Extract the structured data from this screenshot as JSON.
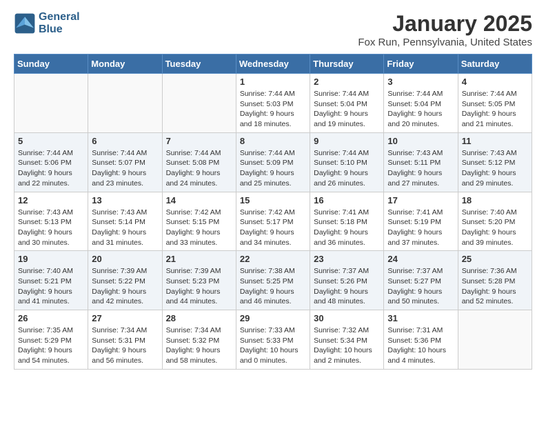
{
  "logo": {
    "line1": "General",
    "line2": "Blue"
  },
  "title": "January 2025",
  "location": "Fox Run, Pennsylvania, United States",
  "days_header": [
    "Sunday",
    "Monday",
    "Tuesday",
    "Wednesday",
    "Thursday",
    "Friday",
    "Saturday"
  ],
  "weeks": [
    [
      {
        "day": "",
        "content": ""
      },
      {
        "day": "",
        "content": ""
      },
      {
        "day": "",
        "content": ""
      },
      {
        "day": "1",
        "content": "Sunrise: 7:44 AM\nSunset: 5:03 PM\nDaylight: 9 hours\nand 18 minutes."
      },
      {
        "day": "2",
        "content": "Sunrise: 7:44 AM\nSunset: 5:04 PM\nDaylight: 9 hours\nand 19 minutes."
      },
      {
        "day": "3",
        "content": "Sunrise: 7:44 AM\nSunset: 5:04 PM\nDaylight: 9 hours\nand 20 minutes."
      },
      {
        "day": "4",
        "content": "Sunrise: 7:44 AM\nSunset: 5:05 PM\nDaylight: 9 hours\nand 21 minutes."
      }
    ],
    [
      {
        "day": "5",
        "content": "Sunrise: 7:44 AM\nSunset: 5:06 PM\nDaylight: 9 hours\nand 22 minutes."
      },
      {
        "day": "6",
        "content": "Sunrise: 7:44 AM\nSunset: 5:07 PM\nDaylight: 9 hours\nand 23 minutes."
      },
      {
        "day": "7",
        "content": "Sunrise: 7:44 AM\nSunset: 5:08 PM\nDaylight: 9 hours\nand 24 minutes."
      },
      {
        "day": "8",
        "content": "Sunrise: 7:44 AM\nSunset: 5:09 PM\nDaylight: 9 hours\nand 25 minutes."
      },
      {
        "day": "9",
        "content": "Sunrise: 7:44 AM\nSunset: 5:10 PM\nDaylight: 9 hours\nand 26 minutes."
      },
      {
        "day": "10",
        "content": "Sunrise: 7:43 AM\nSunset: 5:11 PM\nDaylight: 9 hours\nand 27 minutes."
      },
      {
        "day": "11",
        "content": "Sunrise: 7:43 AM\nSunset: 5:12 PM\nDaylight: 9 hours\nand 29 minutes."
      }
    ],
    [
      {
        "day": "12",
        "content": "Sunrise: 7:43 AM\nSunset: 5:13 PM\nDaylight: 9 hours\nand 30 minutes."
      },
      {
        "day": "13",
        "content": "Sunrise: 7:43 AM\nSunset: 5:14 PM\nDaylight: 9 hours\nand 31 minutes."
      },
      {
        "day": "14",
        "content": "Sunrise: 7:42 AM\nSunset: 5:15 PM\nDaylight: 9 hours\nand 33 minutes."
      },
      {
        "day": "15",
        "content": "Sunrise: 7:42 AM\nSunset: 5:17 PM\nDaylight: 9 hours\nand 34 minutes."
      },
      {
        "day": "16",
        "content": "Sunrise: 7:41 AM\nSunset: 5:18 PM\nDaylight: 9 hours\nand 36 minutes."
      },
      {
        "day": "17",
        "content": "Sunrise: 7:41 AM\nSunset: 5:19 PM\nDaylight: 9 hours\nand 37 minutes."
      },
      {
        "day": "18",
        "content": "Sunrise: 7:40 AM\nSunset: 5:20 PM\nDaylight: 9 hours\nand 39 minutes."
      }
    ],
    [
      {
        "day": "19",
        "content": "Sunrise: 7:40 AM\nSunset: 5:21 PM\nDaylight: 9 hours\nand 41 minutes."
      },
      {
        "day": "20",
        "content": "Sunrise: 7:39 AM\nSunset: 5:22 PM\nDaylight: 9 hours\nand 42 minutes."
      },
      {
        "day": "21",
        "content": "Sunrise: 7:39 AM\nSunset: 5:23 PM\nDaylight: 9 hours\nand 44 minutes."
      },
      {
        "day": "22",
        "content": "Sunrise: 7:38 AM\nSunset: 5:25 PM\nDaylight: 9 hours\nand 46 minutes."
      },
      {
        "day": "23",
        "content": "Sunrise: 7:37 AM\nSunset: 5:26 PM\nDaylight: 9 hours\nand 48 minutes."
      },
      {
        "day": "24",
        "content": "Sunrise: 7:37 AM\nSunset: 5:27 PM\nDaylight: 9 hours\nand 50 minutes."
      },
      {
        "day": "25",
        "content": "Sunrise: 7:36 AM\nSunset: 5:28 PM\nDaylight: 9 hours\nand 52 minutes."
      }
    ],
    [
      {
        "day": "26",
        "content": "Sunrise: 7:35 AM\nSunset: 5:29 PM\nDaylight: 9 hours\nand 54 minutes."
      },
      {
        "day": "27",
        "content": "Sunrise: 7:34 AM\nSunset: 5:31 PM\nDaylight: 9 hours\nand 56 minutes."
      },
      {
        "day": "28",
        "content": "Sunrise: 7:34 AM\nSunset: 5:32 PM\nDaylight: 9 hours\nand 58 minutes."
      },
      {
        "day": "29",
        "content": "Sunrise: 7:33 AM\nSunset: 5:33 PM\nDaylight: 10 hours\nand 0 minutes."
      },
      {
        "day": "30",
        "content": "Sunrise: 7:32 AM\nSunset: 5:34 PM\nDaylight: 10 hours\nand 2 minutes."
      },
      {
        "day": "31",
        "content": "Sunrise: 7:31 AM\nSunset: 5:36 PM\nDaylight: 10 hours\nand 4 minutes."
      },
      {
        "day": "",
        "content": ""
      }
    ]
  ]
}
